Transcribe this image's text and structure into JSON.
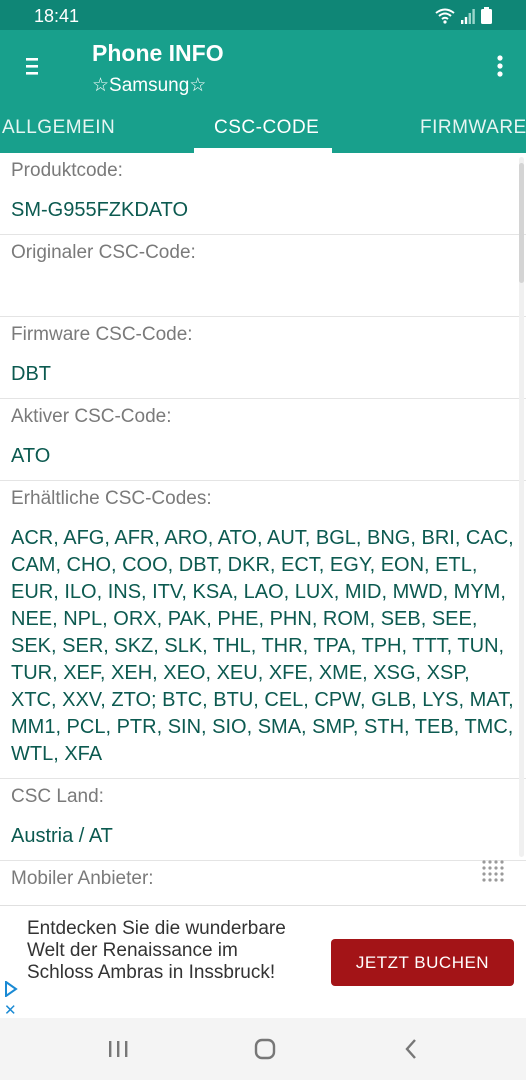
{
  "status_bar": {
    "time": "18:41"
  },
  "app_bar": {
    "title": "Phone INFO",
    "subtitle": "☆Samsung☆"
  },
  "tabs": [
    {
      "label": "ALLGEMEIN"
    },
    {
      "label": "CSC-CODE"
    },
    {
      "label": "FIRMWARE"
    }
  ],
  "sections": [
    {
      "label": "Produktcode:",
      "value": "SM-G955FZKDATO"
    },
    {
      "label": "Originaler CSC-Code:",
      "value": ""
    },
    {
      "label": "Firmware CSC-Code:",
      "value": "DBT"
    },
    {
      "label": "Aktiver CSC-Code:",
      "value": "ATO"
    },
    {
      "label": "Erhältliche CSC-Codes:",
      "value": "ACR, AFG, AFR, ARO, ATO, AUT, BGL, BNG, BRI, CAC, CAM, CHO, COO, DBT, DKR, ECT, EGY, EON, ETL, EUR, ILO, INS, ITV, KSA, LAO, LUX, MID, MWD, MYM, NEE, NPL, ORX, PAK, PHE, PHN, ROM, SEB, SEE, SEK, SER, SKZ, SLK, THL, THR, TPA, TPH, TTT, TUN, TUR, XEF, XEH, XEO, XEU, XFE, XME, XSG, XSP, XTC, XXV, ZTO; BTC, BTU, CEL, CPW, GLB, LYS, MAT, MM1, PCL, PTR, SIN, SIO, SMA, SMP, STH, TEB, TMC, WTL, XFA"
    },
    {
      "label": "CSC Land:",
      "value": "Austria / AT"
    },
    {
      "label": "Mobiler Anbieter:",
      "value": ""
    }
  ],
  "ad": {
    "text": "Entdecken Sie die wunderbare Welt der Renaissance im Schloss Ambras in Inssbruck!",
    "button_label": "JETZT BUCHEN",
    "close_label": "✕",
    "button_color": "#a31417"
  },
  "colors": {
    "primary": "#18a08c",
    "status": "#0f8676",
    "value_text": "#0c5a50"
  }
}
